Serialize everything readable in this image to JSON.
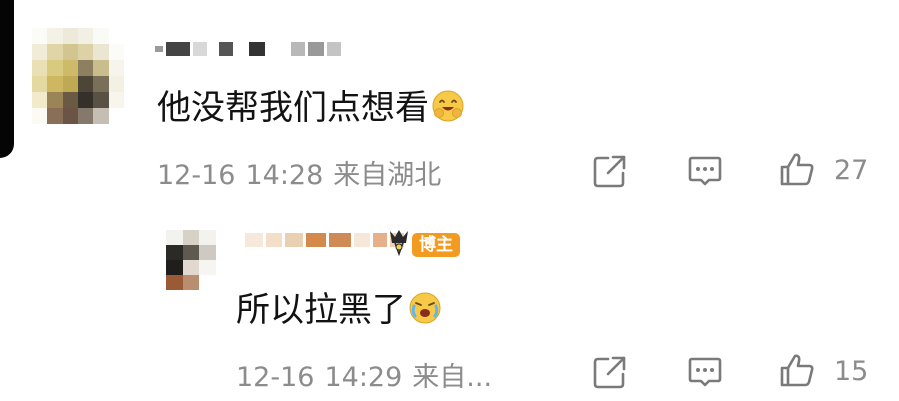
{
  "comment": {
    "text": "他没帮我们点想看",
    "emoji": "grinning-hug-emoji",
    "date": "12-16",
    "time": "14:28",
    "location": "来自湖北",
    "like_count": "27"
  },
  "reply": {
    "badge": "博主",
    "text": "所以拉黑了",
    "emoji": "tearful-laugh-emoji",
    "date": "12-16",
    "time": "14:29",
    "location": "来自...",
    "like_count": "15"
  },
  "colors": {
    "text_primary": "#121212",
    "text_meta": "#8c8c8c",
    "badge_bg": "#f39a21",
    "icon_stroke": "#7a7a7a",
    "emoji_yellow": "#f7c948"
  },
  "icons": {
    "repost": "share-square-icon",
    "comment": "comment-bubble-icon",
    "like": "thumbs-up-icon"
  }
}
